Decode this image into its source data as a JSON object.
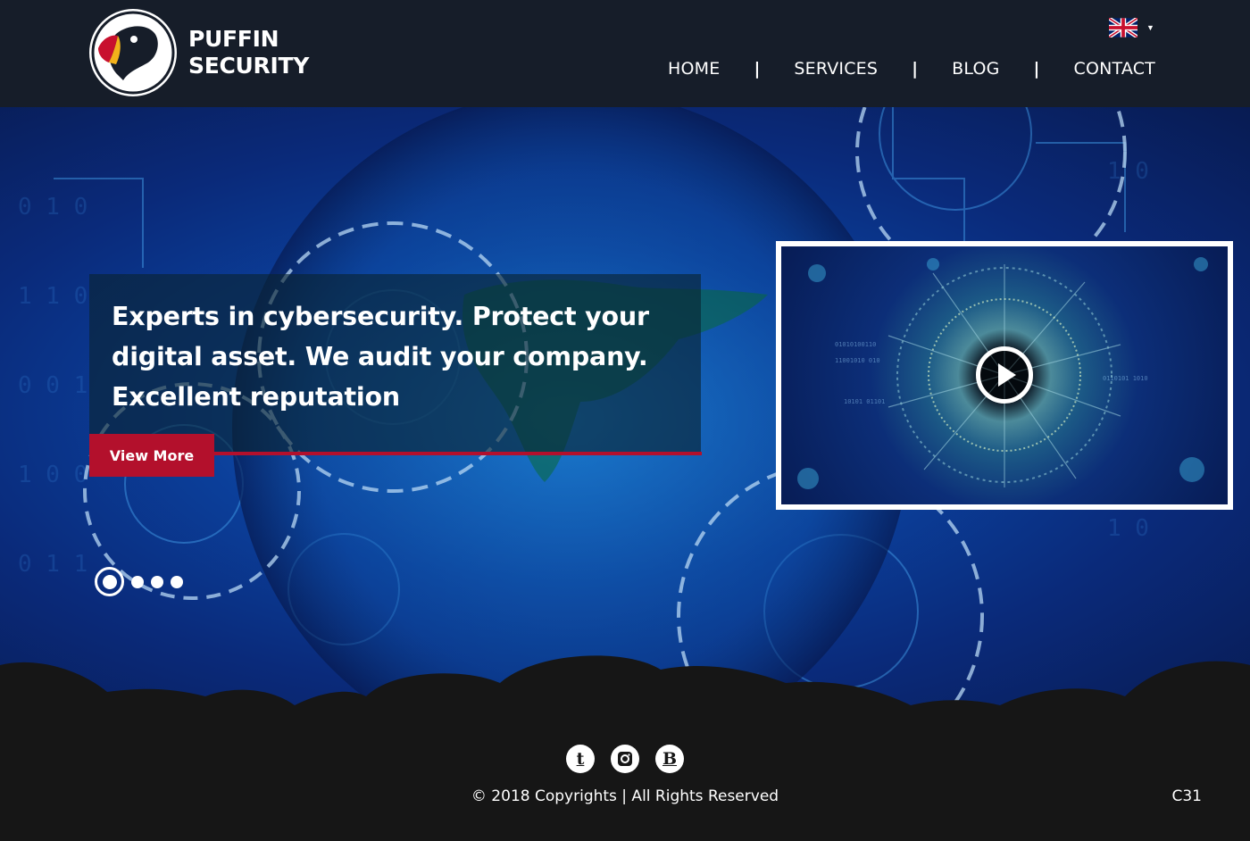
{
  "header": {
    "brand_line1": "PUFFIN",
    "brand_line2": "SECURITY",
    "language": "English (UK)",
    "nav": [
      {
        "label": "HOME"
      },
      {
        "label": "SERVICES"
      },
      {
        "label": "BLOG"
      },
      {
        "label": "CONTACT"
      }
    ],
    "nav_separator": "|"
  },
  "hero": {
    "title": "Experts in cybersecurity. Protect your digital asset. We audit your company. Excellent reputation",
    "cta_label": "View More",
    "slides_total": 4,
    "active_slide": 1
  },
  "video": {
    "play_icon": "play-icon"
  },
  "footer": {
    "social": [
      {
        "icon": "tumblr-icon",
        "glyph": "t"
      },
      {
        "icon": "instagram-icon",
        "glyph": ""
      },
      {
        "icon": "blogger-icon",
        "glyph": "B"
      }
    ],
    "copyright": "© 2018 Copyrights | All Rights Reserved",
    "code": "C31"
  },
  "colors": {
    "header_bg": "#161d29",
    "accent_red": "#b3102c",
    "footer_bg": "#161616"
  }
}
